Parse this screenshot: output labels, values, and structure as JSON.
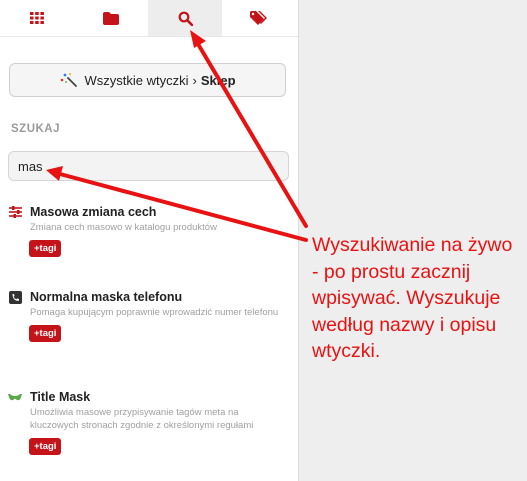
{
  "tabs": [
    {
      "name": "grid",
      "icon": "grid-icon"
    },
    {
      "name": "folder",
      "icon": "folder-icon"
    },
    {
      "name": "search",
      "icon": "search-icon",
      "active": true
    },
    {
      "name": "tags",
      "icon": "tags-icon"
    }
  ],
  "breadcrumb": {
    "all": "Wszystkie wtyczki",
    "separator": "›",
    "current": "Sklep",
    "icon": "magic-wand-icon"
  },
  "search": {
    "title": "SZUKAJ",
    "value": "mas"
  },
  "items": [
    {
      "title": "Masowa zmiana cech",
      "desc": "Zmiana cech masowo w katalogu produktów",
      "tag": "+tagi",
      "icon": "sliders-icon"
    },
    {
      "title": "Normalna maska telefonu",
      "desc": "Pomaga kupującym poprawnie wprowadzić numer telefonu",
      "tag": "+tagi",
      "icon": "phone-icon"
    },
    {
      "title": "Title Mask",
      "desc": "Umożliwia masowe przypisywanie tagów meta na kluczowych stronach zgodnie z określonymi regułami",
      "tag": "+tagi",
      "icon": "mask-icon"
    }
  ],
  "annotation": "Wyszukiwanie na żywo - po prostu zacznij wpisywać. Wyszukuje według nazwy i opisu wtyczki.",
  "colors": {
    "accent": "#c4141a",
    "annotation": "#e81212"
  }
}
